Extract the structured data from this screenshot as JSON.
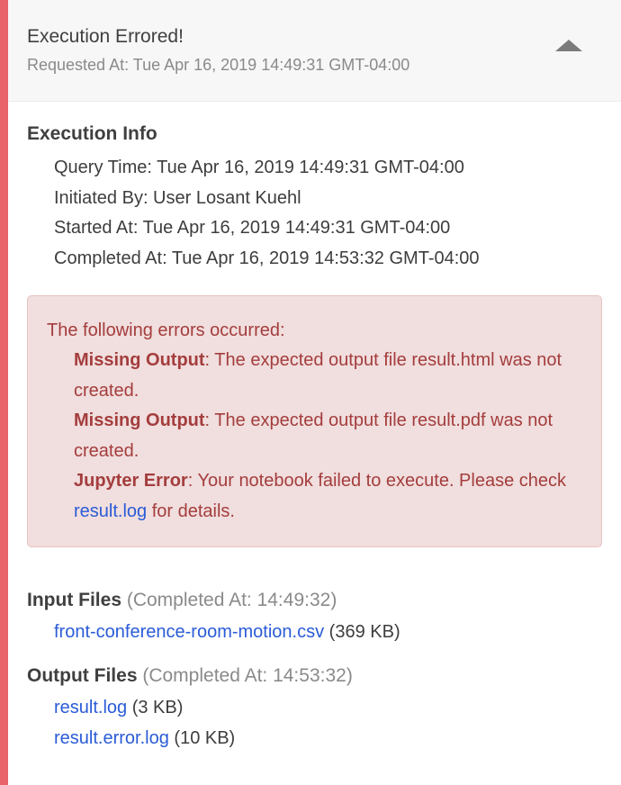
{
  "header": {
    "title": "Execution Errored!",
    "requested_at": "Requested At: Tue Apr 16, 2019 14:49:31 GMT-04:00",
    "collapse_icon": "caret-up-icon"
  },
  "execution_info": {
    "title": "Execution Info",
    "rows": [
      "Query Time: Tue Apr 16, 2019 14:49:31 GMT-04:00",
      "Initiated By: User Losant Kuehl",
      "Started At: Tue Apr 16, 2019 14:49:31 GMT-04:00",
      "Completed At: Tue Apr 16, 2019 14:53:32 GMT-04:00"
    ]
  },
  "errors": {
    "heading": "The following errors occurred:",
    "items": [
      {
        "label": "Missing Output",
        "text": ": The expected output file result.html was not created."
      },
      {
        "label": "Missing Output",
        "text": ": The expected output file result.pdf was not created."
      },
      {
        "label": "Jupyter Error",
        "text": ": Your notebook failed to execute. Please check ",
        "link": "result.log",
        "after": " for details."
      }
    ],
    "colors": {
      "background": "#f1dede",
      "text": "#a43d3d"
    }
  },
  "input_files": {
    "title": "Input Files",
    "completed": "(Completed At: 14:49:32)",
    "files": [
      {
        "name": "front-conference-room-motion.csv",
        "size": "(369 KB)"
      }
    ]
  },
  "output_files": {
    "title": "Output Files",
    "completed": "(Completed At: 14:53:32)",
    "files": [
      {
        "name": "result.log",
        "size": "(3 KB)"
      },
      {
        "name": "result.error.log",
        "size": "(10 KB)"
      }
    ]
  },
  "colors": {
    "accent_error": "#e8636a",
    "link": "#2a5bd7"
  }
}
